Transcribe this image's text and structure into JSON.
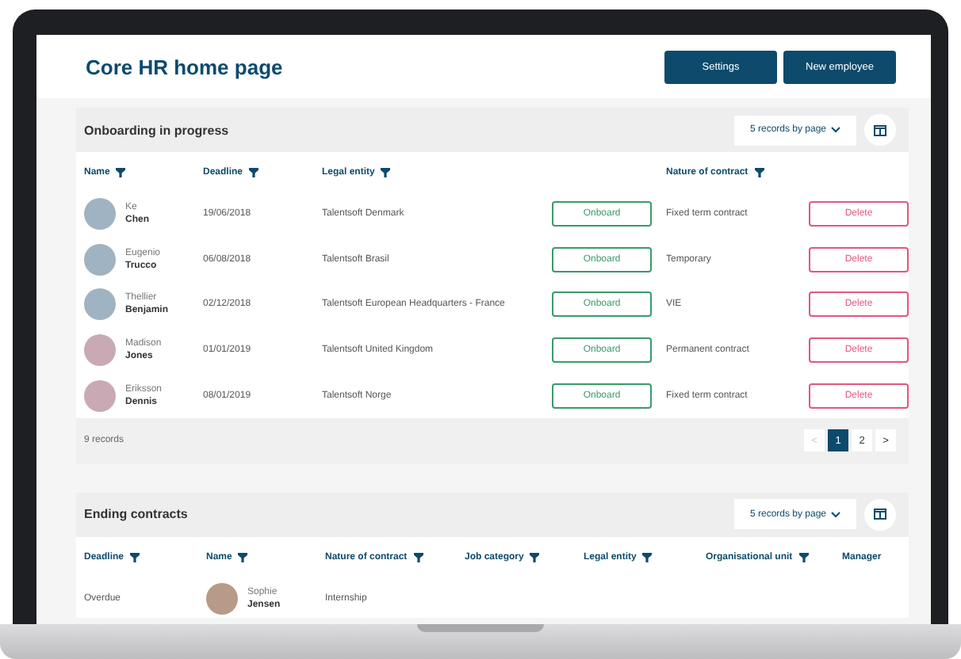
{
  "page": {
    "title": "Core HR home page"
  },
  "buttons": [
    {
      "label": "Settings"
    },
    {
      "label": "New employee"
    }
  ],
  "onboarding": {
    "title": "Onboarding in progress",
    "page_size": "5 records by page",
    "columns": [
      {
        "label": "Name",
        "filter": true
      },
      {
        "label": "Deadline",
        "filter": true
      },
      {
        "label": "Legal entity",
        "filter": true
      },
      {
        "label": "Nature of contract",
        "filter": true
      }
    ],
    "rows": [
      {
        "first_name": "Ke",
        "last_name": "Chen",
        "color": "#9fb3c2",
        "deadline": "19/06/2018",
        "legal_entity": "Talentsoft Denmark",
        "action": "Onboard",
        "contract": "Fixed term contract",
        "delete": "Delete"
      },
      {
        "first_name": "Eugenio",
        "last_name": "Trucco",
        "color": "#9fb3c2",
        "deadline": "06/08/2018",
        "legal_entity": "Talentsoft Brasil",
        "action": "Onboard",
        "contract": "Temporary",
        "delete": "Delete"
      },
      {
        "first_name": "Thellier",
        "last_name": "Benjamin",
        "color": "#9fb3c2",
        "deadline": "02/12/2018",
        "legal_entity": "Talentsoft European Headquarters - France",
        "action": "Onboard",
        "contract": "VIE",
        "delete": "Delete"
      },
      {
        "first_name": "Madison",
        "last_name": "Jones",
        "color": "#c9a9b4",
        "deadline": "01/01/2019",
        "legal_entity": "Talentsoft United Kingdom",
        "action": "Onboard",
        "contract": "Permanent contract",
        "delete": "Delete"
      },
      {
        "first_name": "Eriksson",
        "last_name": "Dennis",
        "color": "#c9a9b4",
        "deadline": "08/01/2019",
        "legal_entity": "Talentsoft Norge",
        "action": "Onboard",
        "contract": "Fixed term contract",
        "delete": "Delete"
      }
    ],
    "footer": {
      "count": "9 records",
      "prev": "<",
      "prev_disabled": true,
      "next": ">",
      "pages": [
        {
          "label": "1",
          "selected": true
        },
        {
          "label": "2",
          "selected": false
        }
      ]
    }
  },
  "ending": {
    "title": "Ending contracts",
    "page_size": "5 records by page",
    "columns": [
      {
        "label": "Deadline",
        "filter": true
      },
      {
        "label": "Name",
        "filter": true
      },
      {
        "label": "Nature of contract",
        "filter": true
      },
      {
        "label": "Job category",
        "filter": true
      },
      {
        "label": "Legal entity",
        "filter": true
      },
      {
        "label": "Organisational unit",
        "filter": true
      },
      {
        "label": "Manager",
        "filter": false
      }
    ],
    "rows": [
      {
        "deadline": "Overdue",
        "first_name": "Sophie",
        "last_name": "Jensen",
        "color": "#b89a88",
        "contract": "Internship"
      }
    ]
  }
}
